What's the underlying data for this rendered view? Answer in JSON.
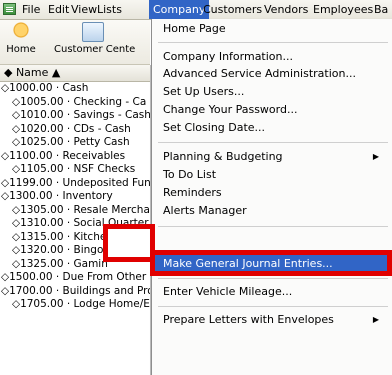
{
  "menubar": {
    "items": [
      "File",
      "Edit",
      "View",
      "Lists",
      "Company",
      "Customers",
      "Vendors",
      "Employees",
      "Ba"
    ],
    "active": "Company"
  },
  "toolbar": {
    "home_label": "Home",
    "customer_center_label": "Customer Cente"
  },
  "list": {
    "header": "◆  Name  ▲",
    "rows": [
      {
        "text": "◇1000.00 · Cash",
        "level": 0
      },
      {
        "text": "◇1005.00 · Checking - Ca",
        "level": 1
      },
      {
        "text": "◇1010.00 · Savings - Cash",
        "level": 1
      },
      {
        "text": "◇1020.00 · CDs - Cash",
        "level": 1
      },
      {
        "text": "◇1025.00 · Petty Cash",
        "level": 1
      },
      {
        "text": "◇1100.00 · Receivables",
        "level": 0
      },
      {
        "text": "◇1105.00 · NSF Checks",
        "level": 1
      },
      {
        "text": "◇1199.00 · Undeposited Fun",
        "level": 0
      },
      {
        "text": "◇1300.00 · Inventory",
        "level": 0
      },
      {
        "text": "◇1305.00 · Resale Mercha",
        "level": 1
      },
      {
        "text": "◇1310.00 · Social Quarter",
        "level": 1
      },
      {
        "text": "◇1315.00 · Kitche",
        "level": 1
      },
      {
        "text": "◇1320.00 · Bingo",
        "level": 1
      },
      {
        "text": "◇1325.00 · Gamin",
        "level": 1
      },
      {
        "text": "◇1500.00 · Due From Other",
        "level": 0
      },
      {
        "text": "◇1700.00 · Buildings and Prop",
        "level": 0
      },
      {
        "text": "◇1705.00 · Lodge Home/E",
        "level": 1
      }
    ]
  },
  "company_menu": {
    "items": [
      {
        "label": "Home Page",
        "submenu": false
      },
      {
        "label": "Company Information...",
        "submenu": false
      },
      {
        "label": "Advanced Service Administration...",
        "submenu": false
      },
      {
        "label": "Set Up Users...",
        "submenu": false
      },
      {
        "label": "Change Your Password...",
        "submenu": false
      },
      {
        "label": "Set Closing Date...",
        "submenu": false
      },
      {
        "label": "Planning & Budgeting",
        "submenu": true
      },
      {
        "label": "To Do List",
        "submenu": false
      },
      {
        "label": "Reminders",
        "submenu": false
      },
      {
        "label": "Alerts Manager",
        "submenu": false
      },
      {
        "label": "Make General Journal Entries...",
        "submenu": false
      },
      {
        "label": "Enter Vehicle Mileage...",
        "submenu": false
      },
      {
        "label": "Prepare Letters with Envelopes",
        "submenu": true
      }
    ],
    "highlighted": "Make General Journal Entries..."
  },
  "colors": {
    "accent": "#3165c6",
    "annotation": "#e00000"
  },
  "icons": {
    "menubar": "qb-app-icon",
    "home": "home-icon",
    "customer_center": "customer-center-icon",
    "submenu": "submenu-arrow-icon"
  }
}
